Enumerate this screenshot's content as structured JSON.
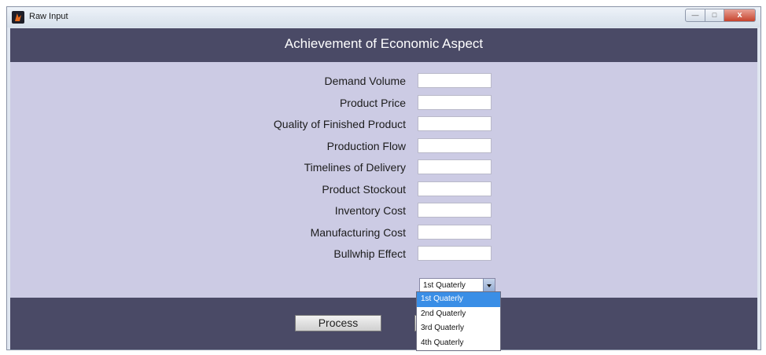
{
  "window": {
    "title": "Raw Input",
    "controls": {
      "minimize": "",
      "maximize": "",
      "close": "x"
    }
  },
  "header": {
    "title": "Achievement of Economic Aspect"
  },
  "form": {
    "fields": [
      {
        "label": "Demand Volume",
        "value": ""
      },
      {
        "label": "Product Price",
        "value": ""
      },
      {
        "label": "Quality of Finished Product",
        "value": ""
      },
      {
        "label": "Production Flow",
        "value": ""
      },
      {
        "label": "Timelines of Delivery",
        "value": ""
      },
      {
        "label": "Product Stockout",
        "value": ""
      },
      {
        "label": "Inventory Cost",
        "value": ""
      },
      {
        "label": "Manufacturing Cost",
        "value": ""
      },
      {
        "label": "Bullwhip Effect",
        "value": ""
      }
    ],
    "quarter_select": {
      "selected": "1st Quaterly",
      "options": [
        "1st Quaterly",
        "2nd Quaterly",
        "3rd Quaterly",
        "4th Quaterly"
      ],
      "highlighted_option": "1st Quaterly"
    }
  },
  "actions": {
    "process_label": "Process"
  },
  "colors": {
    "band": "#4a4a66",
    "panel": "#cccbe4",
    "highlight": "#3a8ee6"
  }
}
